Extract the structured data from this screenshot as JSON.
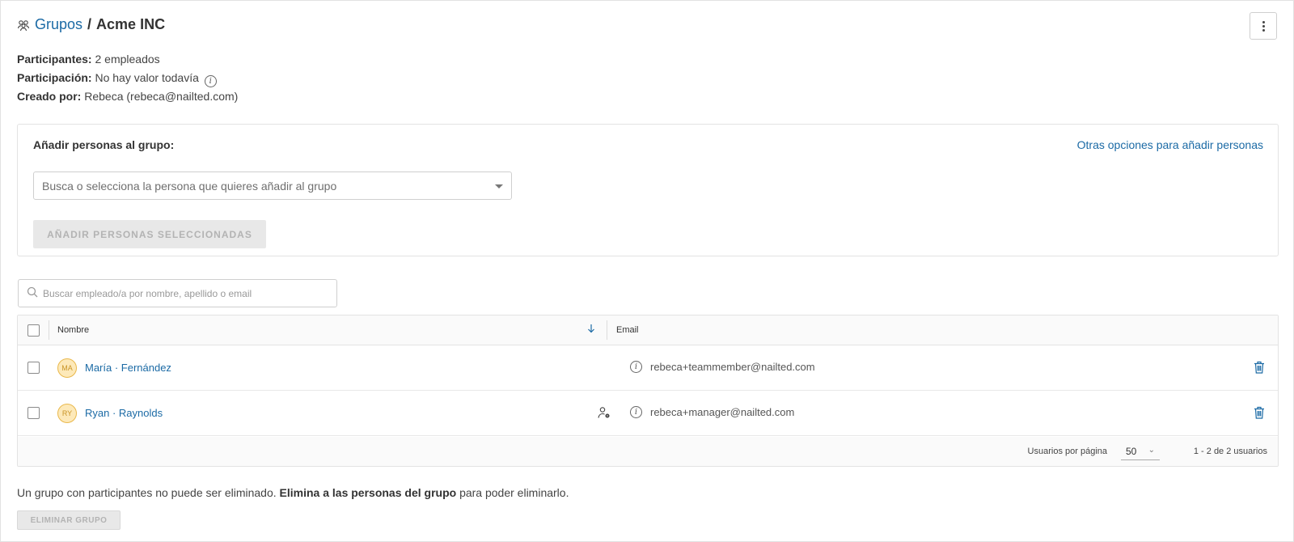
{
  "header": {
    "breadcrumb_link": "Grupos",
    "separator": "/",
    "group_name": "Acme INC"
  },
  "meta": {
    "participants_label": "Participantes:",
    "participants_value": "2 empleados",
    "participation_label": "Participación:",
    "participation_value": "No hay valor todavía",
    "created_label": "Creado por:",
    "created_value": "Rebeca (rebeca@nailted.com)"
  },
  "add_panel": {
    "title": "Añadir personas al grupo:",
    "other_options_link": "Otras opciones para añadir personas",
    "select_placeholder": "Busca o selecciona la persona que quieres añadir al grupo",
    "add_button": "AÑADIR PERSONAS SELECCIONADAS"
  },
  "search": {
    "placeholder": "Buscar empleado/a por nombre, apellido o email"
  },
  "table": {
    "columns": {
      "name": "Nombre",
      "email": "Email"
    },
    "rows": [
      {
        "initials": "MA",
        "name": "María · Fernández",
        "email": "rebeca+teammember@nailted.com",
        "is_manager": false
      },
      {
        "initials": "RY",
        "name": "Ryan · Raynolds",
        "email": "rebeca+manager@nailted.com",
        "is_manager": true
      }
    ],
    "footer": {
      "per_page_label": "Usuarios por página",
      "per_page_value": "50",
      "range": "1 - 2 de 2 usuarios"
    }
  },
  "footer": {
    "notice_pre": "Un grupo con participantes no puede ser eliminado.",
    "notice_bold": "Elimina a las personas del grupo",
    "notice_post": "para poder eliminarlo.",
    "delete_button": "ELIMINAR GRUPO"
  },
  "colors": {
    "link": "#1b6aa5",
    "avatar_bg": "#fde9b9",
    "avatar_border": "#e9b84b",
    "disabled_bg": "#e8e8e8"
  },
  "icons": [
    "group-icon",
    "kebab-menu-icon",
    "info-icon",
    "dropdown-caret-icon",
    "search-icon",
    "sort-arrow-icon",
    "manager-icon",
    "trash-icon",
    "chevron-down-icon"
  ]
}
